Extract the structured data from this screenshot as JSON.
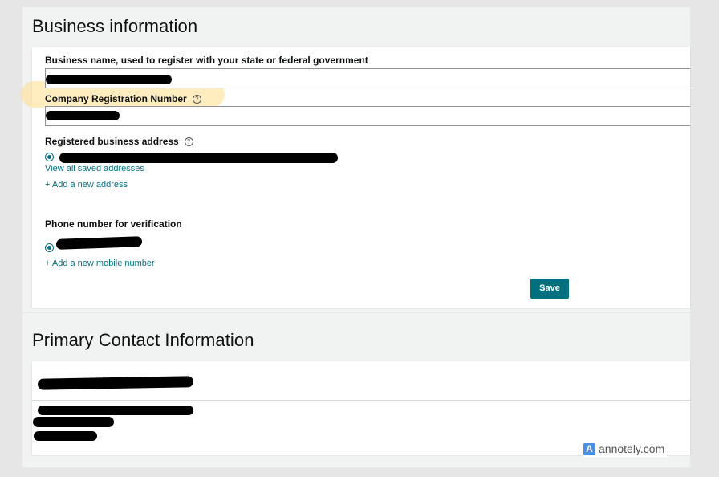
{
  "business": {
    "title": "Business information",
    "business_name_label": "Business name, used to register with your state or federal government",
    "company_reg_label": "Company Registration Number",
    "address_label": "Registered business address",
    "view_addresses": "View all saved addresses",
    "add_address": "+ Add a new address",
    "phone_label": "Phone number for verification",
    "add_mobile": "+ Add a new mobile number",
    "save_label": "Save",
    "help_glyph": "?"
  },
  "contact": {
    "title": "Primary Contact Information"
  },
  "watermark": {
    "icon_glyph": "A",
    "text": "annotely.com"
  },
  "colors": {
    "accent": "#007185",
    "button": "#00707f",
    "highlight": "#ffde8c"
  },
  "icons": {
    "help": "help-circle-icon",
    "radio": "radio-selected-icon",
    "watermark": "annotely-logo-icon"
  }
}
